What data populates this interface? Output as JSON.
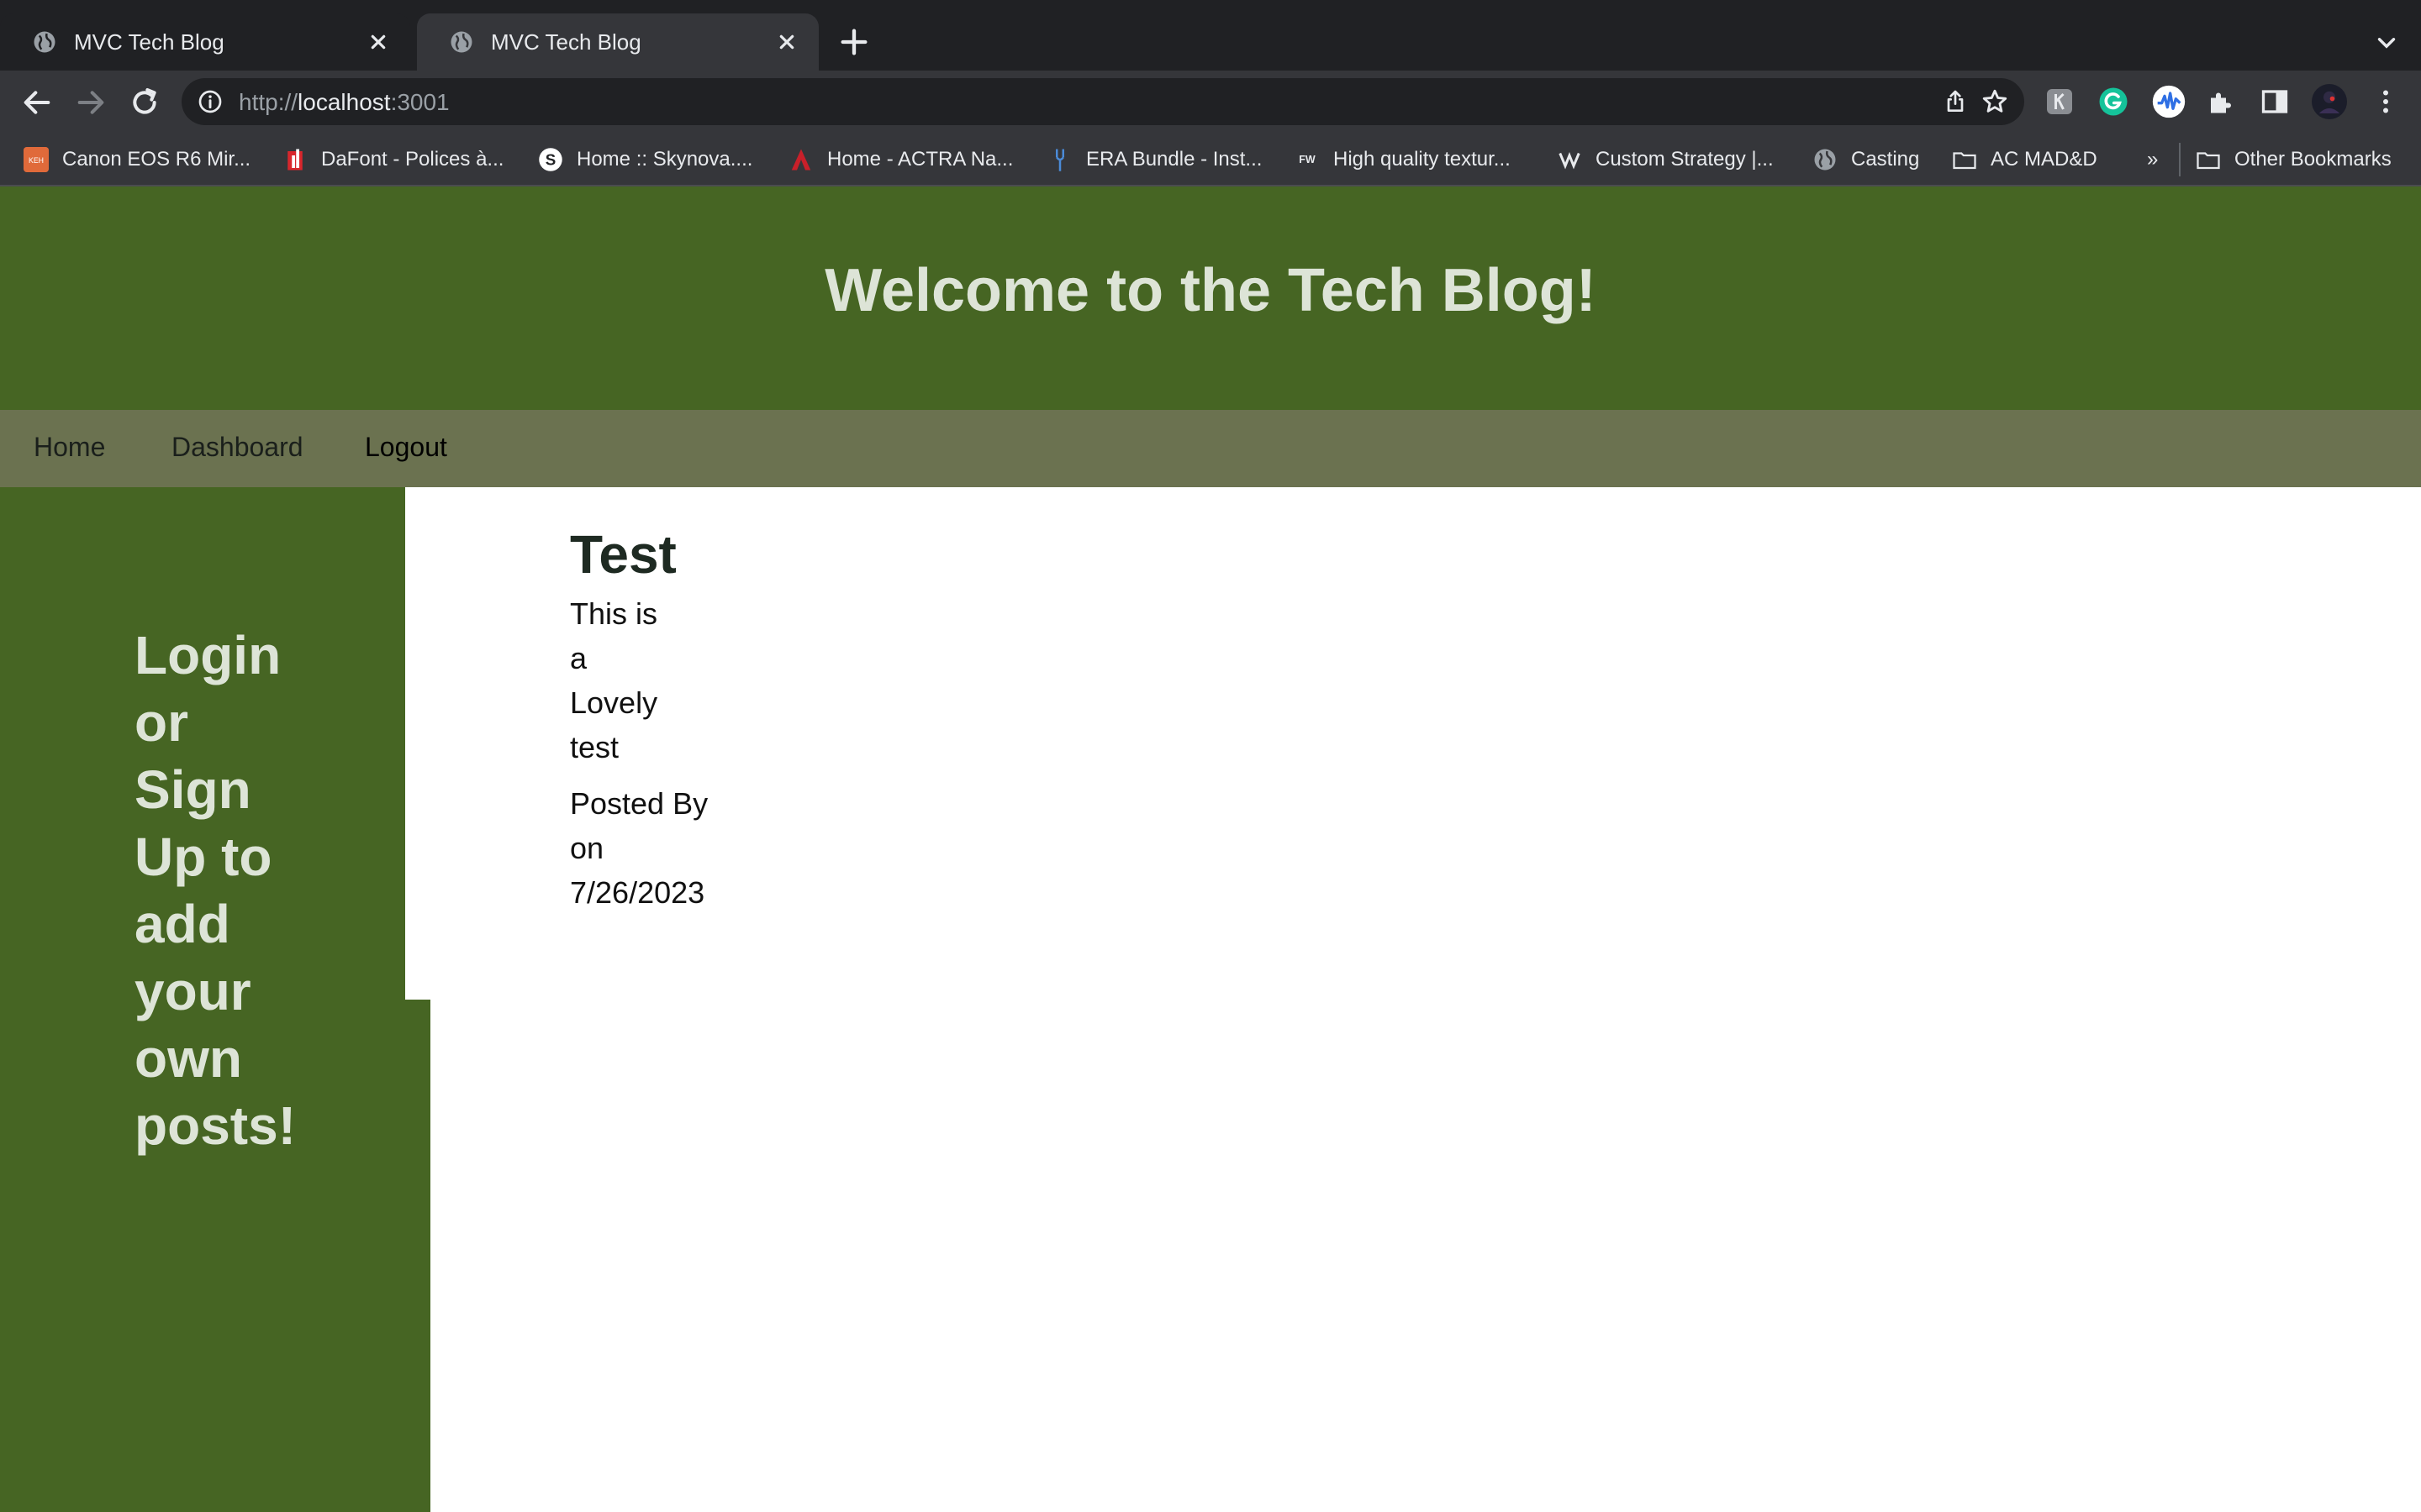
{
  "browser": {
    "tabs": [
      {
        "title": "MVC Tech Blog",
        "active": false
      },
      {
        "title": "MVC Tech Blog",
        "active": true
      }
    ],
    "url_scheme": "http://",
    "url_host": "localhost",
    "url_port": ":3001",
    "bookmarks": [
      {
        "label": "Canon EOS R6 Mir...",
        "icon": "canon-favicon-icon"
      },
      {
        "label": "DaFont - Polices à...",
        "icon": "dafont-favicon-icon"
      },
      {
        "label": "Home :: Skynova....",
        "icon": "skynova-favicon-icon"
      },
      {
        "label": "Home - ACTRA Na...",
        "icon": "actra-favicon-icon"
      },
      {
        "label": "ERA Bundle - Inst...",
        "icon": "era-favicon-icon"
      },
      {
        "label": "High quality textur...",
        "icon": "fw-favicon-icon"
      },
      {
        "label": "Custom Strategy |...",
        "icon": "strategy-favicon-icon"
      },
      {
        "label": "Casting",
        "icon": "globe-icon"
      },
      {
        "label": "AC MAD&D",
        "icon": "folder-icon"
      }
    ],
    "overflow_label": "»",
    "other_bookmarks": "Other Bookmarks"
  },
  "site": {
    "title": "Welcome to the Tech Blog!",
    "nav": [
      "Home",
      "Dashboard",
      "Logout"
    ],
    "sidebar_message": "Login or Sign Up to add your own posts!"
  },
  "post": {
    "title": "Test",
    "body": "This is a Lovely test",
    "meta": "Posted By on 7/26/2023"
  },
  "colors": {
    "header_bg": "#466523",
    "nav_bg": "#6b7250",
    "heading_text": "#dde4d7",
    "chrome_bg": "#202124",
    "toolbar_bg": "#35363a"
  }
}
